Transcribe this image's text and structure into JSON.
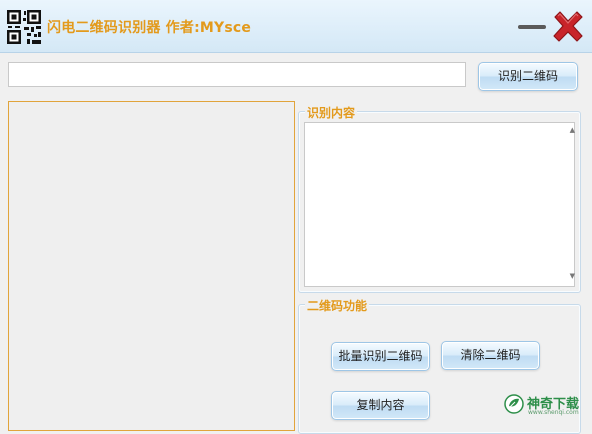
{
  "window": {
    "title": "闪电二维码识别器  作者:MYsce",
    "title_color": "#e39a1c",
    "icon": "qr-code-icon",
    "controls": {
      "minimize_icon": "minimize-icon",
      "close_icon": "close-icon",
      "close_color": "#c8242a"
    }
  },
  "toolbar": {
    "url_input_value": "",
    "recognize_button_label": "识别二维码"
  },
  "image_preview": {
    "accent_color": "#e1a43b"
  },
  "recognition_content": {
    "group_label": "识别内容",
    "text": ""
  },
  "qr_functions": {
    "group_label": "二维码功能",
    "batch_button_label": "批量识别二维码",
    "clear_button_label": "清除二维码",
    "copy_button_label": "复制内容"
  },
  "watermark": {
    "name": "神奇下载",
    "url": "www.shenqi.com",
    "color": "#2e8f4a"
  }
}
